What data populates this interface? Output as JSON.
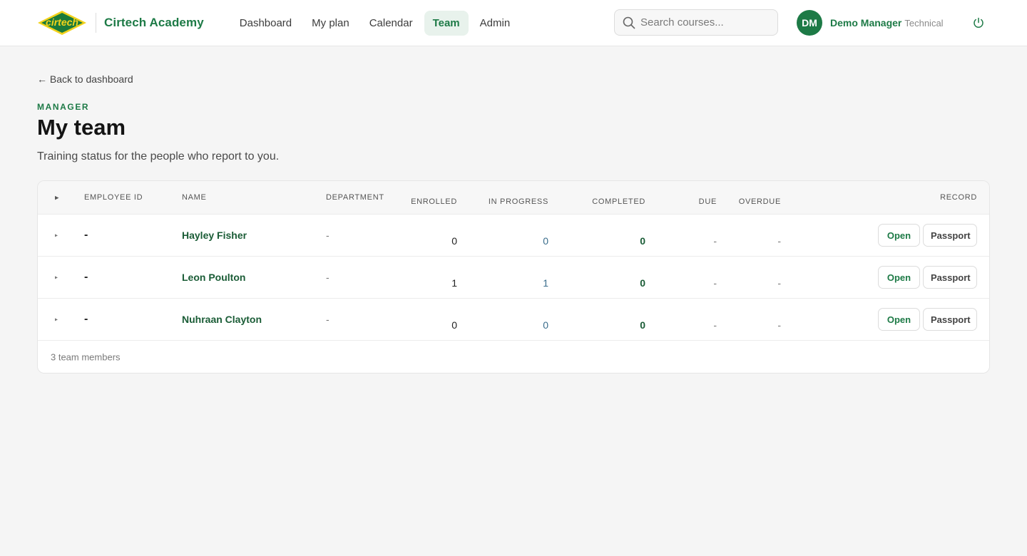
{
  "header": {
    "logo_text": "cirtech",
    "brand": "Cirtech Academy",
    "nav": [
      "Dashboard",
      "My plan",
      "Calendar",
      "Team",
      "Admin"
    ],
    "active_nav": "Team",
    "search_placeholder": "Search courses...",
    "user": {
      "initials": "DM",
      "name": "Demo Manager",
      "role": "Technical"
    },
    "icons": {
      "search": "search-icon",
      "power": "power-icon"
    },
    "colors": {
      "brand": "#1d7a46",
      "logo_bg": "#1a7a3a",
      "logo_accent": "#f2d21b"
    }
  },
  "main": {
    "back_link": "← Back to dashboard",
    "eyebrow": "MANAGER",
    "title": "My team",
    "subtitle": "Training status for the people who report to you.",
    "table": {
      "expand_glyph": "▸",
      "columns": {
        "employee_id": "EMPLOYEE ID",
        "name": "NAME",
        "department": "DEPARTMENT",
        "enrolled": "ENROLLED",
        "in_progress": "IN PROGRESS",
        "completed": "COMPLETED",
        "due": "DUE",
        "overdue": "OVERDUE",
        "record": "RECORD"
      },
      "rows": [
        {
          "employee_id": "-",
          "name": "Hayley Fisher",
          "department": "-",
          "enrolled": "0",
          "in_progress": "0",
          "completed": "0",
          "due": "-",
          "overdue": "-",
          "open": "Open",
          "passport": "Passport"
        },
        {
          "employee_id": "-",
          "name": "Leon Poulton",
          "department": "-",
          "enrolled": "1",
          "in_progress": "1",
          "completed": "0",
          "due": "-",
          "overdue": "-",
          "open": "Open",
          "passport": "Passport"
        },
        {
          "employee_id": "-",
          "name": "Nuhraan Clayton",
          "department": "-",
          "enrolled": "0",
          "in_progress": "0",
          "completed": "0",
          "due": "-",
          "overdue": "-",
          "open": "Open",
          "passport": "Passport"
        }
      ],
      "footer": "3 team members"
    }
  }
}
